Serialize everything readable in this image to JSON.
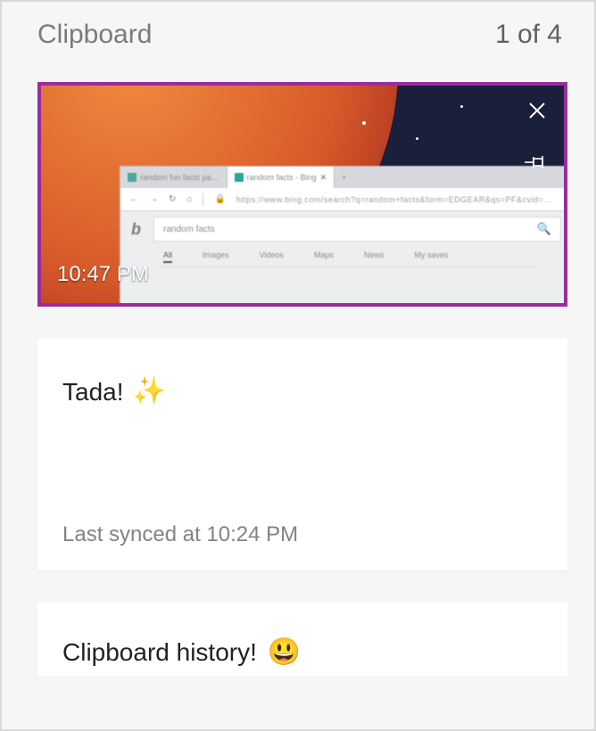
{
  "header": {
    "title": "Clipboard",
    "counter": "1 of 4"
  },
  "items": [
    {
      "type": "image",
      "timestamp": "10:47 PM",
      "close_icon": "close-icon",
      "pin_icon": "pin-icon"
    },
    {
      "type": "text",
      "text": "Tada!",
      "emoji": "✨",
      "sync_status": "Last synced at 10:24 PM"
    },
    {
      "type": "text",
      "text": "Clipboard history!",
      "emoji": "😃"
    }
  ]
}
